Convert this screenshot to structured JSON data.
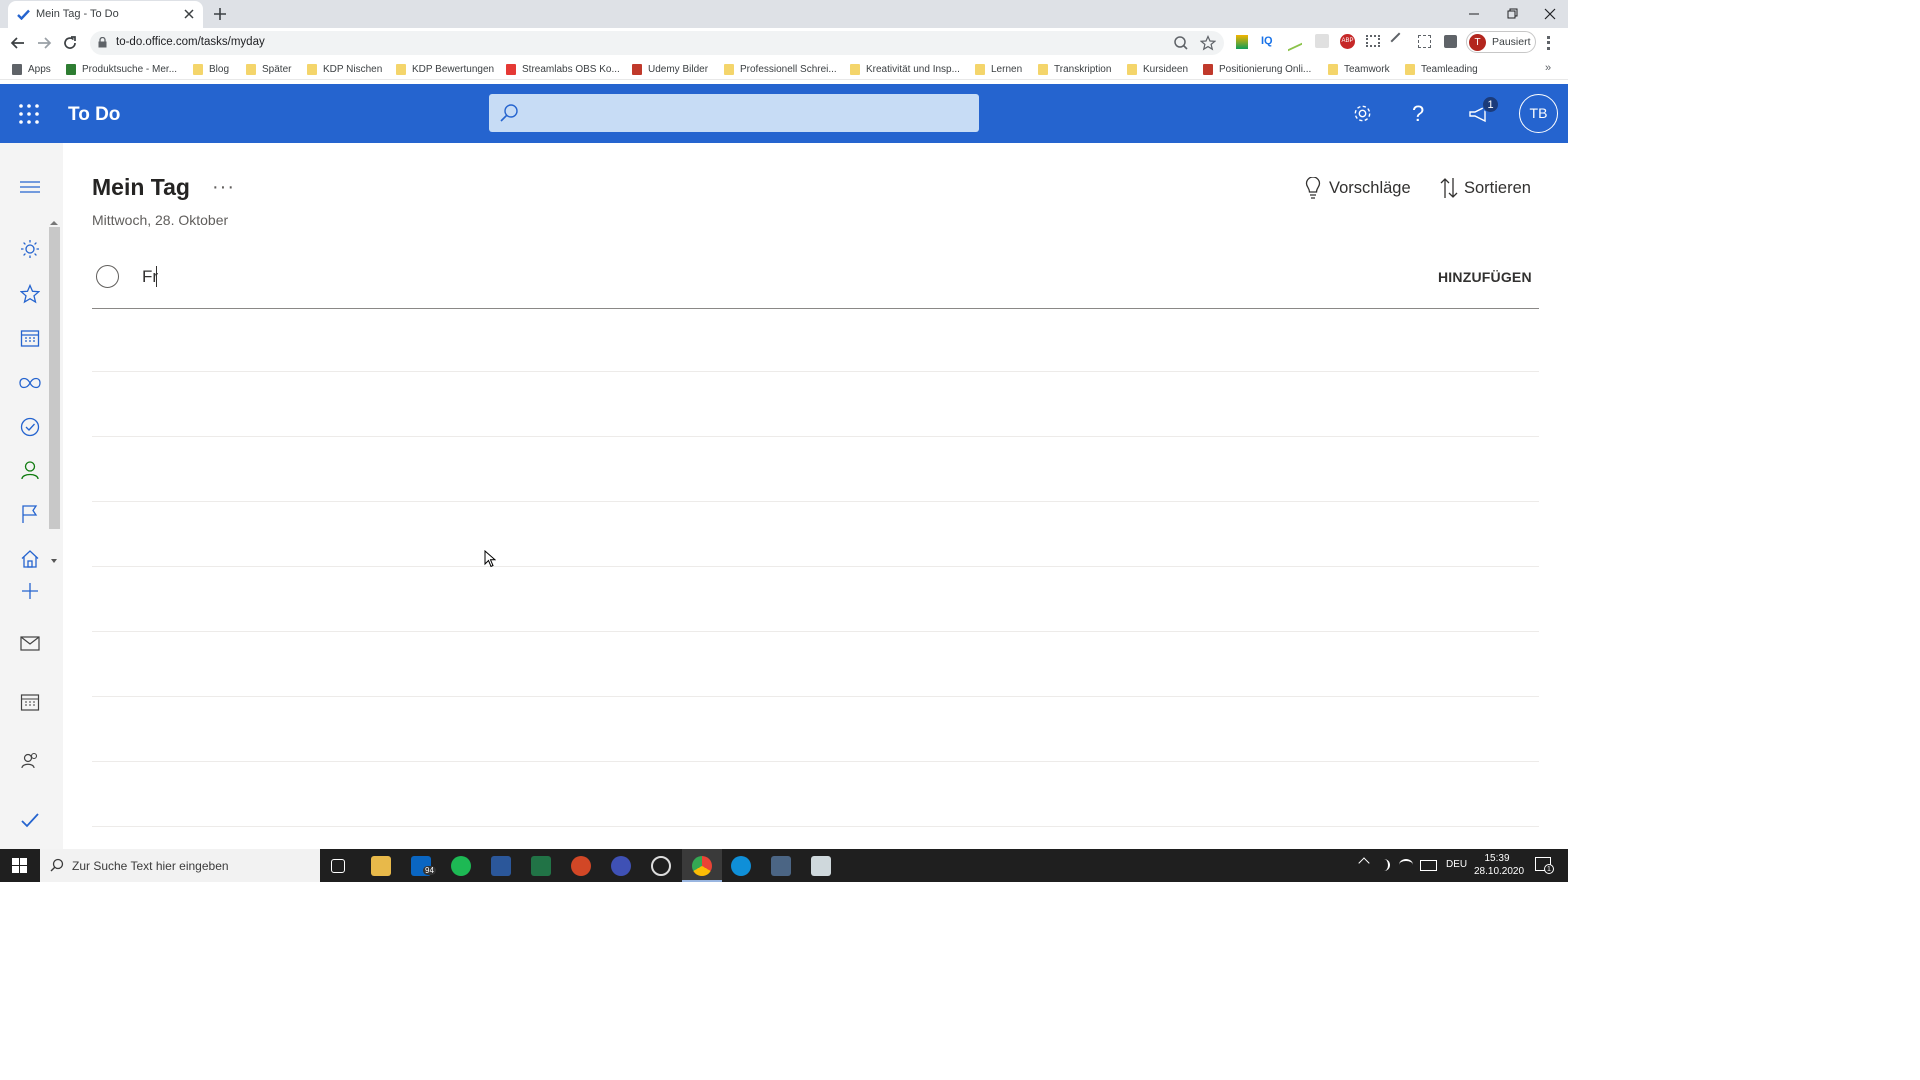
{
  "browser": {
    "tab_title": "Mein Tag - To Do",
    "url": "to-do.office.com/tasks/myday",
    "profile_initial": "T",
    "profile_status": "Pausiert",
    "bookmarks": [
      {
        "label": "Apps",
        "icon": "apps-grid-icon",
        "color": "#5f6368"
      },
      {
        "label": "Produktsuche - Mer...",
        "icon": "site-favicon",
        "color": "#2e7d32"
      },
      {
        "label": "Blog",
        "icon": "folder-icon",
        "color": "#f4d56b"
      },
      {
        "label": "Später",
        "icon": "folder-icon",
        "color": "#f4d56b"
      },
      {
        "label": "KDP Nischen",
        "icon": "folder-icon",
        "color": "#f4d56b"
      },
      {
        "label": "KDP Bewertungen",
        "icon": "folder-icon",
        "color": "#f4d56b"
      },
      {
        "label": "Streamlabs OBS Ko...",
        "icon": "youtube-icon",
        "color": "#e53935"
      },
      {
        "label": "Udemy Bilder",
        "icon": "udemy-icon",
        "color": "#c0392b"
      },
      {
        "label": "Professionell Schrei...",
        "icon": "folder-icon",
        "color": "#f4d56b"
      },
      {
        "label": "Kreativität und Insp...",
        "icon": "folder-icon",
        "color": "#f4d56b"
      },
      {
        "label": "Lernen",
        "icon": "folder-icon",
        "color": "#f4d56b"
      },
      {
        "label": "Transkription",
        "icon": "folder-icon",
        "color": "#f4d56b"
      },
      {
        "label": "Kursideen",
        "icon": "folder-icon",
        "color": "#f4d56b"
      },
      {
        "label": "Positionierung Onli...",
        "icon": "udemy-icon",
        "color": "#c0392b"
      },
      {
        "label": "Teamwork",
        "icon": "folder-icon",
        "color": "#f4d56b"
      },
      {
        "label": "Teamleading",
        "icon": "folder-icon",
        "color": "#f4d56b"
      }
    ]
  },
  "app": {
    "title": "To Do",
    "accent_color": "#2564cf",
    "notification_count": "1",
    "avatar_initials": "TB"
  },
  "sidebar": {
    "items": [
      {
        "name": "nav-my-day",
        "icon": "sun-icon"
      },
      {
        "name": "nav-important",
        "icon": "star-icon"
      },
      {
        "name": "nav-planned",
        "icon": "calendar-icon"
      },
      {
        "name": "nav-all",
        "icon": "infinity-icon"
      },
      {
        "name": "nav-completed",
        "icon": "check-circle-icon"
      },
      {
        "name": "nav-assigned",
        "icon": "person-icon"
      },
      {
        "name": "nav-flagged",
        "icon": "flag-icon"
      },
      {
        "name": "nav-tasks",
        "icon": "home-icon"
      },
      {
        "name": "nav-new-list",
        "icon": "plus-icon"
      }
    ],
    "apps": [
      "mail-icon",
      "calendar-icon",
      "people-icon",
      "todo-icon"
    ]
  },
  "main": {
    "title": "Mein Tag",
    "date": "Mittwoch, 28. Oktober",
    "suggestions_label": "Vorschläge",
    "sort_label": "Sortieren",
    "new_task_value": "Fr",
    "add_button_label": "HINZUFÜGEN"
  },
  "taskbar": {
    "search_placeholder": "Zur Suche Text hier eingeben",
    "mail_badge": "94",
    "language": "DEU",
    "time": "15:39",
    "date": "28.10.2020",
    "action_center_count": "1"
  }
}
